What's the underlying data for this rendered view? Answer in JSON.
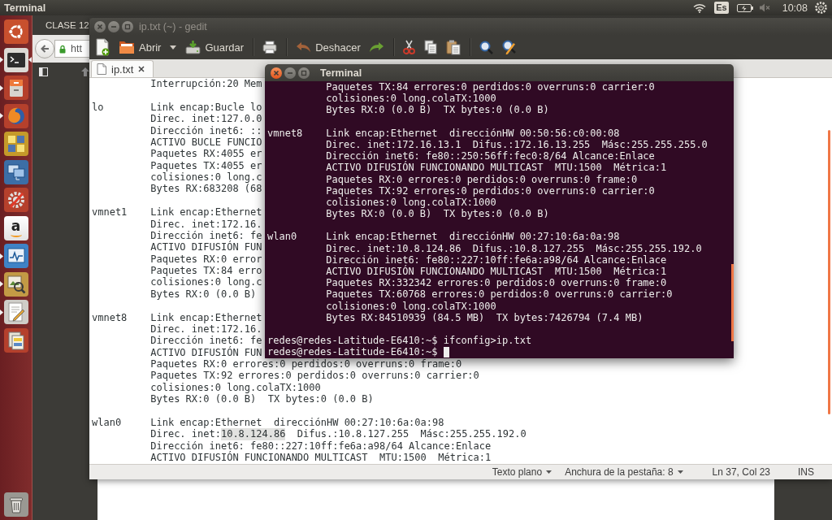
{
  "top_panel": {
    "app_title": "Terminal",
    "keyboard_layout": "Es",
    "sound_muted": true,
    "clock": "10:08"
  },
  "launcher": {
    "items": [
      {
        "kind": "dash",
        "running": false,
        "focused": false
      },
      {
        "kind": "terminal",
        "running": true,
        "focused": true
      },
      {
        "kind": "files",
        "running": true,
        "focused": false
      },
      {
        "kind": "browser",
        "running": true,
        "focused": false
      },
      {
        "kind": "vmware",
        "running": false,
        "focused": false
      },
      {
        "kind": "remote",
        "running": false,
        "focused": false
      },
      {
        "kind": "tools",
        "running": false,
        "focused": false
      },
      {
        "kind": "store",
        "label": "a",
        "running": false,
        "focused": false
      },
      {
        "kind": "monitor",
        "running": true,
        "focused": false
      },
      {
        "kind": "viewer",
        "running": true,
        "focused": false
      },
      {
        "kind": "editor",
        "running": true,
        "focused": false
      },
      {
        "kind": "docs",
        "running": false,
        "focused": false
      },
      {
        "kind": "trash",
        "running": false,
        "focused": false
      }
    ]
  },
  "browser": {
    "tab": "CLASE 12",
    "url": "htt"
  },
  "gedit": {
    "title": "ip.txt (~) - gedit",
    "focused": false,
    "toolbar": [
      {
        "kind": "new"
      },
      {
        "kind": "open",
        "label": "Abrir"
      },
      {
        "kind": "menu"
      },
      {
        "kind": "save",
        "label": "Guardar"
      },
      {
        "kind": "separator"
      },
      {
        "kind": "print"
      },
      {
        "kind": "separator"
      },
      {
        "kind": "undo",
        "label": "Deshacer"
      },
      {
        "kind": "redo"
      },
      {
        "kind": "separator"
      },
      {
        "kind": "cut"
      },
      {
        "kind": "copy"
      },
      {
        "kind": "paste"
      },
      {
        "kind": "separator"
      },
      {
        "kind": "find"
      },
      {
        "kind": "replace"
      }
    ],
    "tabs": [
      {
        "label": "ip.txt",
        "selected": true
      }
    ],
    "blocks": [
      {
        "lines": [
          "Interrupción:20 Mem"
        ]
      },
      {
        "interface": "lo",
        "lines": [
          "Link encap:Bucle lo",
          "Direc. inet:127.0.0",
          "Dirección inet6: ::",
          "ACTIVO BUCLE FUNCIO",
          "Paquetes RX:4055 er",
          "Paquetes TX:4055 er",
          "colisiones:0 long.c",
          "Bytes RX:683208 (68"
        ]
      },
      {
        "interface": "vmnet1",
        "lines": [
          "Link encap:Ethernet",
          "Direc. inet:172.16.",
          "Dirección inet6: fe",
          "ACTIVO DIFUSIÓN FUN",
          "Paquetes RX:0 error",
          "Paquetes TX:84 erro",
          "colisiones:0 long.c",
          "Bytes RX:0 (0.0 B)"
        ]
      },
      {
        "interface": "vmnet8",
        "lines": [
          "Link encap:Ethernet",
          "Direc. inet:172.16.",
          "Dirección inet6: fe",
          "ACTIVO DIFUSIÓN FUN",
          "Paquetes RX:0 errores:0 perdidos:0 overruns:0 frame:0",
          "Paquetes TX:92 errores:0 perdidos:0 overruns:0 carrier:0",
          "colisiones:0 long.colaTX:1000",
          "Bytes RX:0 (0.0 B)  TX bytes:0 (0.0 B)"
        ]
      },
      {
        "interface": "wlan0",
        "lines": [
          "Link encap:Ethernet  direcciónHW 00:27:10:6a:0a:98",
          {
            "segments": [
              {
                "text": "Direc. inet:",
                "highlighted": false
              },
              {
                "text": "10.8.124.86",
                "highlighted": true
              },
              {
                "text": "  Difus.:10.8.127.255  Másc:255.255.192.0",
                "highlighted": false
              }
            ]
          },
          "Dirección inet6: fe80::227:10ff:fe6a:a98/64 Alcance:Enlace",
          "ACTIVO DIFUSIÓN FUNCIONANDO MULTICAST  MTU:1500  Métrica:1"
        ]
      }
    ],
    "status_bar": {
      "language": "Texto plano",
      "tab_width": "Anchura de la pestaña: 8",
      "position": "Ln 37, Col 23",
      "mode": "INS"
    }
  },
  "terminal": {
    "title": "Terminal",
    "focused": true,
    "blocks": [
      {
        "lines": [
          "Paquetes TX:84 errores:0 perdidos:0 overruns:0 carrier:0",
          "colisiones:0 long.colaTX:1000",
          "Bytes RX:0 (0.0 B)  TX bytes:0 (0.0 B)"
        ]
      },
      {
        "interface": "vmnet8",
        "lines": [
          "Link encap:Ethernet  direcciónHW 00:50:56:c0:00:08",
          "Direc. inet:172.16.13.1  Difus.:172.16.13.255  Másc:255.255.255.0",
          "Dirección inet6: fe80::250:56ff:fec0:8/64 Alcance:Enlace",
          "ACTIVO DIFUSIÓN FUNCIONANDO MULTICAST  MTU:1500  Métrica:1",
          "Paquetes RX:0 errores:0 perdidos:0 overruns:0 frame:0",
          "Paquetes TX:92 errores:0 perdidos:0 overruns:0 carrier:0",
          "colisiones:0 long.colaTX:1000",
          "Bytes RX:0 (0.0 B)  TX bytes:0 (0.0 B)"
        ]
      },
      {
        "interface": "wlan0",
        "lines": [
          "Link encap:Ethernet  direcciónHW 00:27:10:6a:0a:98",
          "Direc. inet:10.8.124.86  Difus.:10.8.127.255  Másc:255.255.192.0",
          "Dirección inet6: fe80::227:10ff:fe6a:a98/64 Alcance:Enlace",
          "ACTIVO DIFUSIÓN FUNCIONANDO MULTICAST  MTU:1500  Métrica:1",
          "Paquetes RX:332342 errores:0 perdidos:0 overruns:0 frame:0",
          "Paquetes TX:60768 errores:0 perdidos:0 overruns:0 carrier:0",
          "colisiones:0 long.colaTX:1000",
          "Bytes RX:84510939 (84.5 MB)  TX bytes:7426794 (7.4 MB)"
        ]
      }
    ],
    "prompt_lines": [
      {
        "text": "redes@redes-Latitude-E6410:~$ ifconfig>ip.txt",
        "cursor": false
      },
      {
        "text": "redes@redes-Latitude-E6410:~$",
        "cursor": true
      }
    ]
  }
}
